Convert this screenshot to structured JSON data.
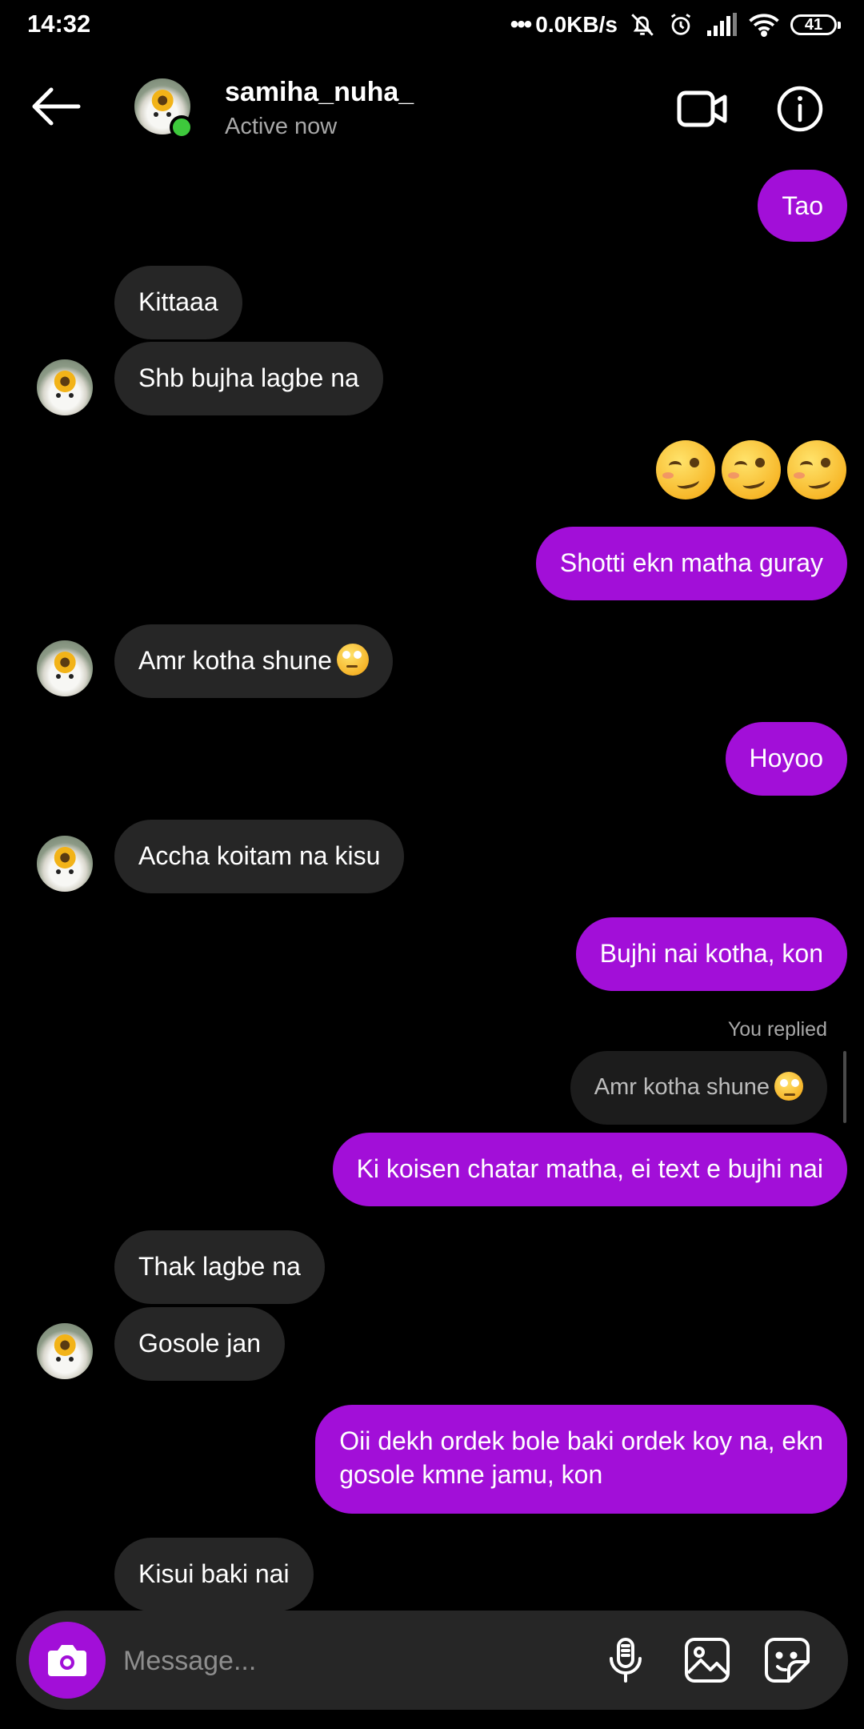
{
  "status_bar": {
    "time": "14:32",
    "speed": "0.0KB/s",
    "battery": "41"
  },
  "header": {
    "username": "samiha_nuha_",
    "status": "Active now",
    "online_color": "#3ec93c"
  },
  "colors": {
    "sent_bubble": "#a20fd8",
    "received_bubble": "#262626",
    "background": "#000000"
  },
  "messages": [
    {
      "from": "me",
      "text": "Tao"
    },
    {
      "from": "them",
      "text": "Kittaaa"
    },
    {
      "from": "them",
      "text": "Shb bujha lagbe na"
    },
    {
      "from": "me",
      "type": "emoji",
      "emoji": "woozy-face",
      "count": 3
    },
    {
      "from": "me",
      "text": "Shotti ekn matha guray"
    },
    {
      "from": "them",
      "text": "Amr kotha shune",
      "emoji": "face-with-rolling-eyes"
    },
    {
      "from": "me",
      "text": "Hoyoo"
    },
    {
      "from": "them",
      "text": "Accha koitam na kisu"
    },
    {
      "from": "me",
      "text": "Bujhi nai kotha, kon"
    },
    {
      "from": "me",
      "reply_label": "You replied",
      "reply_to": "Amr kotha shune",
      "reply_emoji": "face-with-rolling-eyes",
      "text": "Ki koisen chatar matha, ei text e bujhi nai"
    },
    {
      "from": "them",
      "text": "Thak lagbe na"
    },
    {
      "from": "them",
      "text": "Gosole jan"
    },
    {
      "from": "me",
      "text_line1": "Oii dekh ordek bole baki ordek koy na, ekn",
      "text_line2": "gosole kmne jamu, kon"
    },
    {
      "from": "them",
      "text": "Kisui baki nai"
    }
  ],
  "composer": {
    "placeholder": "Message..."
  },
  "icons": {
    "back": "arrow-left-icon",
    "video": "video-call-icon",
    "info": "info-icon",
    "camera": "camera-icon",
    "mic": "microphone-icon",
    "gallery": "gallery-icon",
    "sticker": "sticker-icon"
  }
}
